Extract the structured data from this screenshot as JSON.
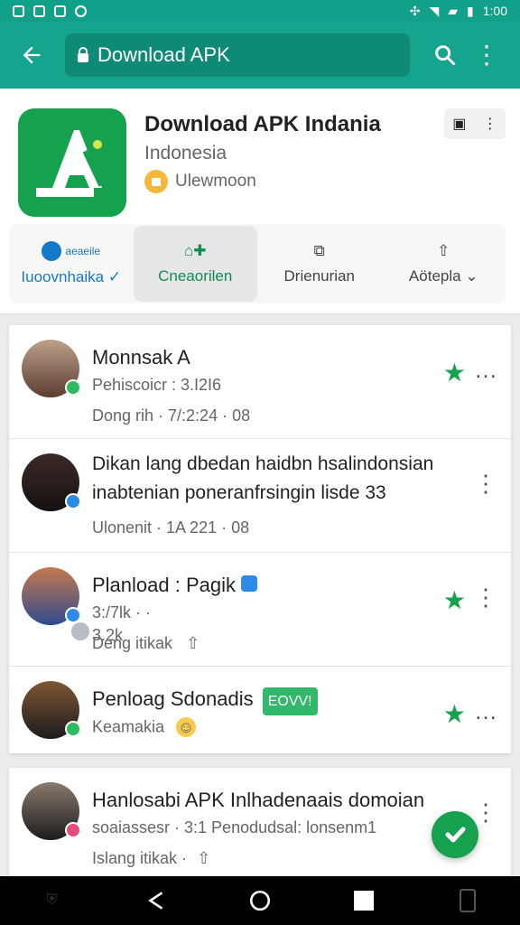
{
  "status_bar": {
    "time": "1:00"
  },
  "app_bar": {
    "url_label": "Download APK"
  },
  "app_card": {
    "title": "Download APK Indania",
    "subtitle": "Indonesia",
    "developer": "Ulewmoon",
    "brand_mini": "aeaeile",
    "actions": [
      {
        "label": "Iuoovnhaika ✓"
      },
      {
        "label": "Cneaorilen"
      },
      {
        "label": "Drienurian"
      },
      {
        "label": "Aötepla"
      }
    ]
  },
  "posts": [
    {
      "title": "Monnsak A",
      "meta": "Pehiscoicr : 3.I2I6",
      "sub": "Dong rih · 7/:2:24 · 08"
    },
    {
      "title": "Dikan lang dbedan haidbn hsalindonsian inabtenian poneranfrsingin lisde 33",
      "meta": "",
      "sub": "Ulonenit · 1A 221 · 08"
    },
    {
      "title": "Planload : Pagik",
      "meta": "3:/7lk · · 3.2k",
      "sub": "Deng itikak"
    },
    {
      "title": "Penloag Sdonadis",
      "badge": "EOVV!",
      "meta": "Keamakia",
      "sub": ""
    }
  ],
  "second_card": {
    "title": "Hanlosabi APK Inlhadenaais domoian",
    "meta": "soaiassesr · 3:1 Penodudsal: lonsenm1",
    "sub": "Islang itikak ·"
  }
}
